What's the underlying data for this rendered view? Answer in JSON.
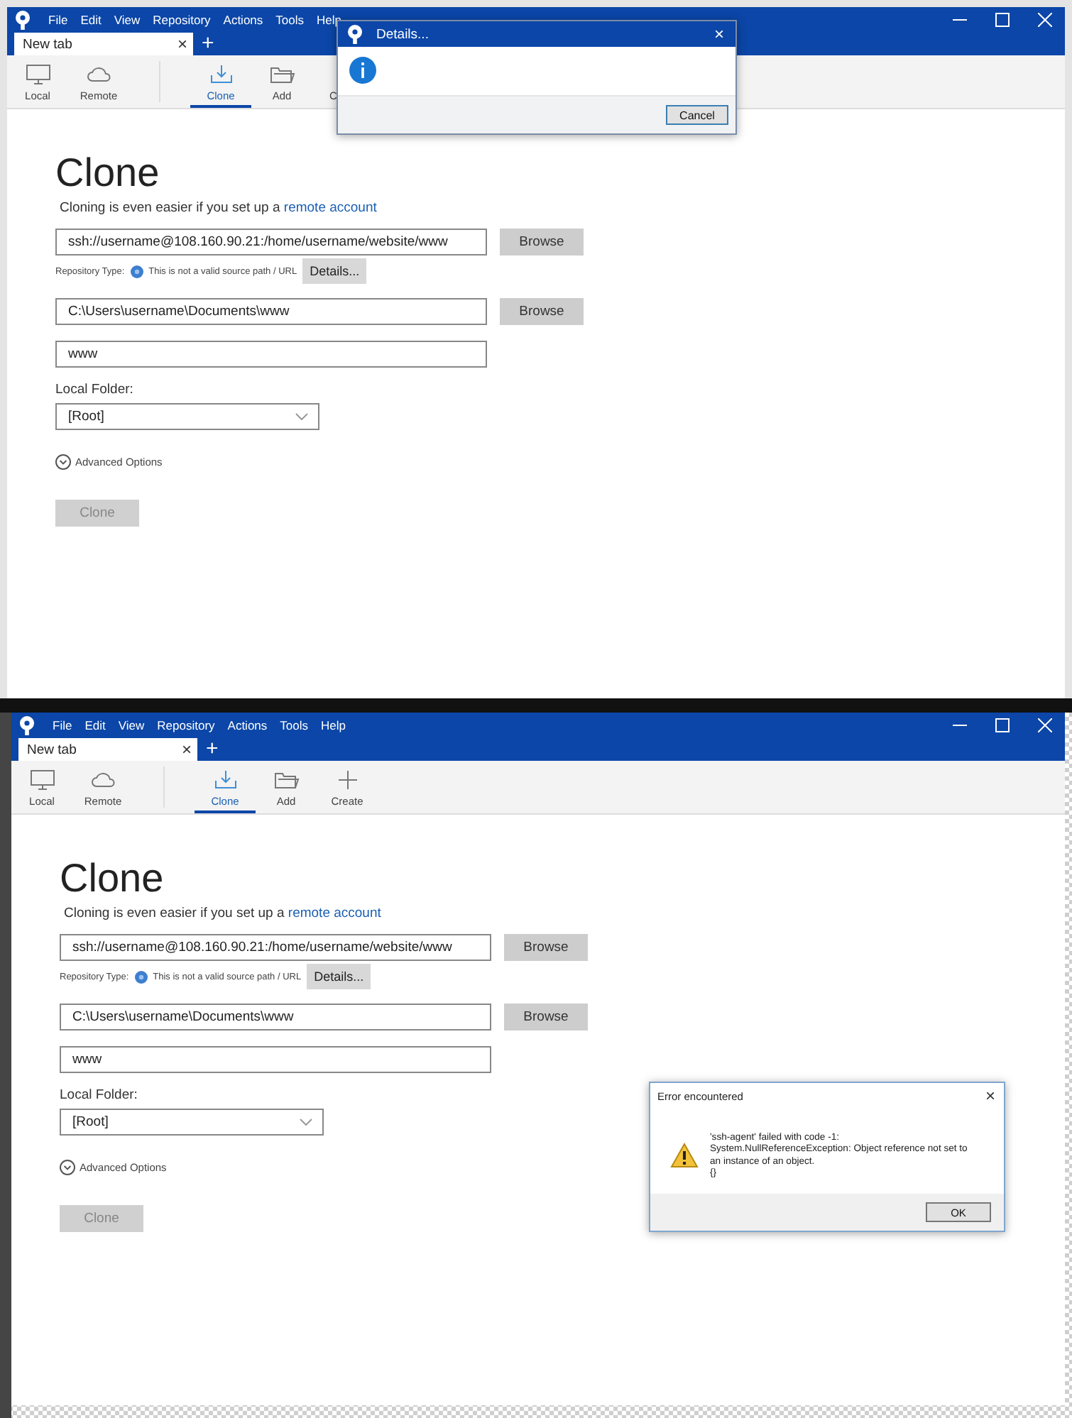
{
  "screens": [
    {
      "menu": [
        "File",
        "Edit",
        "View",
        "Repository",
        "Actions",
        "Tools",
        "Help"
      ],
      "tab": {
        "label": "New tab",
        "close": "×"
      },
      "new_tab": "+",
      "toolbar": [
        {
          "label": "Local",
          "selected": false,
          "kind": "local"
        },
        {
          "label": "Remote",
          "selected": false,
          "kind": "remote"
        },
        {
          "label": "Clone",
          "selected": true,
          "kind": "clone"
        },
        {
          "label": "Add",
          "selected": false,
          "kind": "add"
        },
        {
          "label": "C",
          "selected": false,
          "kind": "cut"
        }
      ],
      "heading": "Clone",
      "subtitle": "Cloning is even easier if you set up a",
      "subtitle_link": "remote account",
      "source": {
        "value": "ssh://username@108.160.90.21:/home/username/website/www",
        "browse": "Browse"
      },
      "repo_type": {
        "label": "Repository Type:",
        "message": "This is not a valid source path / URL",
        "details": "Details..."
      },
      "destination": {
        "value": "C:\\Users\\username\\Documents\\www",
        "browse": "Browse"
      },
      "name": {
        "value": "www"
      },
      "local_folder": {
        "label": "Local Folder:",
        "value": "[Root]"
      },
      "advanced": "Advanced Options",
      "clone_button": {
        "label": "Clone",
        "disabled": true
      },
      "dialog": {
        "kind": "details",
        "title": "Details...",
        "close": "×",
        "button": "Cancel"
      }
    },
    {
      "menu": [
        "File",
        "Edit",
        "View",
        "Repository",
        "Actions",
        "Tools",
        "Help"
      ],
      "tab": {
        "label": "New tab",
        "close": "×"
      },
      "new_tab": "+",
      "toolbar": [
        {
          "label": "Local",
          "selected": false,
          "kind": "local"
        },
        {
          "label": "Remote",
          "selected": false,
          "kind": "remote"
        },
        {
          "label": "Clone",
          "selected": true,
          "kind": "clone"
        },
        {
          "label": "Add",
          "selected": false,
          "kind": "add"
        },
        {
          "label": "Create",
          "selected": false,
          "kind": "create"
        }
      ],
      "heading": "Clone",
      "subtitle": "Cloning is even easier if you set up a",
      "subtitle_link": "remote account",
      "source": {
        "value": "ssh://username@108.160.90.21:/home/username/website/www",
        "browse": "Browse"
      },
      "repo_type": {
        "label": "Repository Type:",
        "message": "This is not a valid source path / URL",
        "details": "Details..."
      },
      "destination": {
        "value": "C:\\Users\\username\\Documents\\www",
        "browse": "Browse"
      },
      "name": {
        "value": "www"
      },
      "local_folder": {
        "label": "Local Folder:",
        "value": "[Root]"
      },
      "advanced": "Advanced Options",
      "clone_button": {
        "label": "Clone",
        "disabled": true
      },
      "dialog": {
        "kind": "error",
        "title": "Error encountered",
        "close": "×",
        "message": "'ssh-agent' failed with code -1:\nSystem.NullReferenceException: Object reference not set to\nan instance of an object.\n{}",
        "button": "OK"
      }
    }
  ]
}
